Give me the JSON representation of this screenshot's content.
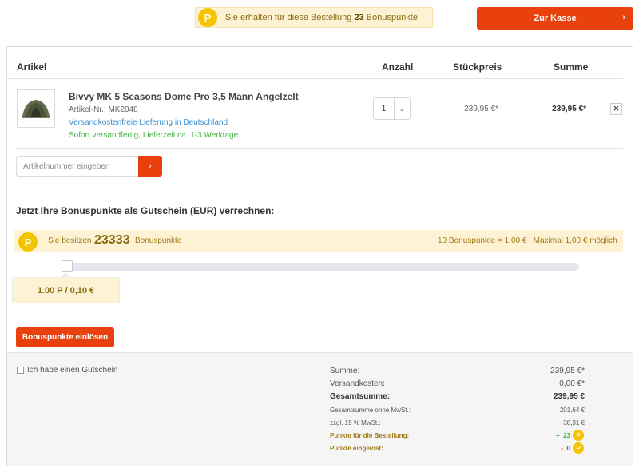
{
  "top": {
    "bonus_prefix": "Sie erhalten für diese Bestellung",
    "bonus_points": "23",
    "bonus_suffix": "Bonuspunkte",
    "coin_letter": "P",
    "checkout_label": "Zur Kasse",
    "checkout_chevron": "›"
  },
  "table": {
    "headers": {
      "article": "Artikel",
      "quantity": "Anzahl",
      "unit_price": "Stückpreis",
      "sum": "Summe"
    }
  },
  "item": {
    "name": "Bivvy MK 5 Seasons Dome Pro 3,5 Mann Angelzelt",
    "article_no": "Artikel-Nr.: MK2048",
    "shipping": "Versandkostenfreie Lieferung in Deutschland",
    "stock": "Sofort versandfertig, Lieferzeit ca. 1-3 Werktage",
    "quantity": "1",
    "quantity_arrow": "⌄",
    "unit_price": "239,95 €*",
    "total": "239,95 €*",
    "remove_label": "✕"
  },
  "article_input": {
    "placeholder": "Artikelnummer eingeben",
    "button": "›"
  },
  "bonus": {
    "heading": "Jetzt Ihre Bonuspunkte als Gutschein (EUR) verrechnen:",
    "own_label": "Sie besitzen",
    "own_points": "23333",
    "own_unit": "Bonuspunkte",
    "rate": "10 Bonuspunkte = 1,00 € | Maximal 1,00 € möglich",
    "slider_value": 0,
    "slider_display": "1.00 P / 0,10 €",
    "redeem_label": "Bonuspunkte einlösen"
  },
  "footer": {
    "voucher_label": "Ich habe einen Gutschein",
    "summary": {
      "sum_label": "Summe:",
      "sum_value": "239,95 €*",
      "shipping_label": "Versandkosten:",
      "shipping_value": "0,00 €*",
      "total_label": "Gesamtsumme:",
      "total_value": "239,95 €",
      "net_label": "Gesamtsumme ohne MwSt.:",
      "net_value": "201,64 €",
      "vat_label": "zzgl. 19 % MwSt.:",
      "vat_value": "38,31 €",
      "points_order_label": "Punkte für die Bestellung:",
      "points_order_sign": "+",
      "points_order_value": "23",
      "points_redeemed_label": "Punkte eingelöst:",
      "points_redeemed_sign": "-",
      "points_redeemed_value": "0"
    }
  },
  "colors": {
    "accent": "#e8410e",
    "coin": "#f5c400",
    "bonus_bg": "#fdf3d4",
    "link_blue": "#3a8fd1",
    "stock_green": "#3fb53f"
  }
}
